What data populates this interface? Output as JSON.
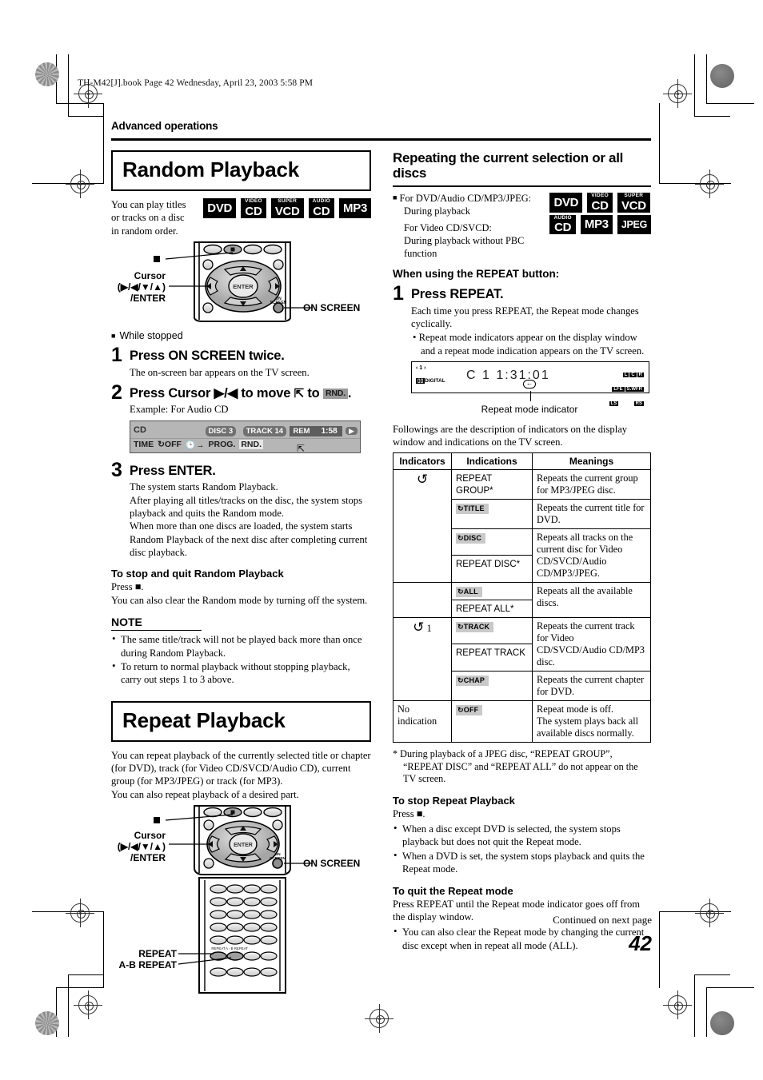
{
  "print_header": "TH-M42[J].book  Page 42  Wednesday, April 23, 2003  5:58 PM",
  "section_label": "Advanced operations",
  "page_number": "42",
  "continued": "Continued on next page",
  "random": {
    "title": "Random Playback",
    "intro": "You can play titles or tracks on a disc in random order.",
    "badges": [
      {
        "top": "",
        "main": "DVD"
      },
      {
        "top": "VIDEO",
        "main": "CD"
      },
      {
        "top": "SUPER",
        "main": "VCD"
      },
      {
        "top": "AUDIO",
        "main": "CD"
      },
      {
        "top": "",
        "main": "MP3"
      }
    ],
    "remote_callouts": {
      "stop": "■",
      "cursor_l1": "Cursor",
      "cursor_l2": "(▶/◀/▼/▲)",
      "cursor_l3": "/ENTER",
      "on_screen": "ON SCREEN",
      "enter": "ENTER"
    },
    "while_stopped": "While stopped",
    "steps": [
      {
        "num": "1",
        "title": "Press ON SCREEN twice.",
        "body": "The on-screen bar appears on the TV screen."
      },
      {
        "num": "2",
        "title_pre": "Press Cursor ▶/◀ to move",
        "title_mid": "to",
        "title_chip": "RND.",
        "title_end": ".",
        "body": "Example: For Audio CD"
      },
      {
        "num": "3",
        "title": "Press ENTER.",
        "body": "The system starts Random Playback.\nAfter playing all titles/tracks on the disc, the system stops playback and quits the Random mode.\nWhen more than one discs are loaded, the system starts Random Playback of the next disc after completing current disc playback."
      }
    ],
    "osd": {
      "disc_type": "CD",
      "disc": "DISC 3",
      "track": "TRACK 14",
      "rem_label": "REM",
      "rem_time": "1:58",
      "arrow": "▶",
      "items": [
        "TIME",
        "OFF",
        "PROG.",
        "RND."
      ],
      "repeat_item": "OFF",
      "clock_item": "→",
      "selected": "RND."
    },
    "stop_heading": "To stop and quit Random Playback",
    "stop_press": "Press ■.",
    "stop_note": "You can also clear the Random mode by turning off the system.",
    "note_heading": "NOTE",
    "notes": [
      "The same title/track will not be played back more than once during Random Playback.",
      "To return to normal playback without stopping playback, carry out steps 1 to 3 above."
    ]
  },
  "repeat": {
    "title": "Repeat Playback",
    "intro": "You can repeat playback of the currently selected title or chapter (for DVD), track (for Video CD/SVCD/Audio CD), current group (for MP3/JPEG) or track (for MP3).\nYou can also repeat playback of a desired part.",
    "callouts": {
      "stop": "■",
      "cursor_l1": "Cursor",
      "cursor_l2": "(▶/◀/▼/▲)",
      "cursor_l3": "/ENTER",
      "on_screen": "ON SCREEN",
      "repeat": "REPEAT",
      "ab_repeat": "A-B REPEAT",
      "key_repeat": "REPEAT",
      "key_ab": "A-B REPEAT"
    }
  },
  "repeating": {
    "title": "Repeating the current selection or all discs",
    "cond_line1": "For DVD/Audio CD/MP3/JPEG:",
    "cond_line2": "During playback",
    "cond_line3": "For Video CD/SVCD:",
    "cond_line4": "During playback without PBC function",
    "badges": [
      {
        "top": "",
        "main": "DVD"
      },
      {
        "top": "VIDEO",
        "main": "CD"
      },
      {
        "top": "SUPER",
        "main": "VCD"
      },
      {
        "top": "AUDIO",
        "main": "CD"
      },
      {
        "top": "",
        "main": "MP3"
      },
      {
        "top": "",
        "main": "JPEG"
      }
    ],
    "when_using": "When using the REPEAT button:",
    "step": {
      "num": "1",
      "title": "Press REPEAT.",
      "body": "Each time you press REPEAT, the Repeat mode changes cyclically.",
      "bullet": "Repeat mode indicators appear on the display window and a repeat mode indication appears on the TV screen."
    },
    "display": {
      "top_left": "‹ 1 ›",
      "bottom_left": "DIGITAL",
      "segments": "C 1      1:31:01",
      "right_indicators": [
        "L",
        "C",
        "R",
        "LFE",
        "S.WFR",
        "LS",
        "RS"
      ]
    },
    "caption": "Repeat mode indicator",
    "table_intro": "Followings are the description of indicators on the display window and indications on the TV screen.",
    "table": {
      "headers": [
        "Indicators",
        "Indications",
        "Meanings"
      ],
      "rows": [
        {
          "indicator": "↺",
          "indicator_style": "arrow",
          "indicator_suffix": "",
          "indications": [
            {
              "text": "REPEAT GROUP*",
              "style": "plain"
            }
          ],
          "meaning": "Repeats the current group for MP3/JPEG disc."
        },
        {
          "indications": [
            {
              "text": "TITLE",
              "style": "chip"
            }
          ],
          "meaning": "Repeats the current title for DVD."
        },
        {
          "indications": [
            {
              "text": "DISC",
              "style": "chip"
            },
            {
              "text": "REPEAT DISC*",
              "style": "plain"
            }
          ],
          "meaning": "Repeats all tracks on the current disc for Video CD/SVCD/Audio CD/MP3/JPEG."
        },
        {
          "indications": [
            {
              "text": "ALL",
              "style": "chip"
            },
            {
              "text": "REPEAT ALL*",
              "style": "plain"
            }
          ],
          "meaning": "Repeats all the available discs."
        },
        {
          "indicator": "↺",
          "indicator_style": "arrow",
          "indicator_suffix": "1",
          "indications": [
            {
              "text": "TRACK",
              "style": "chip"
            },
            {
              "text": "REPEAT TRACK",
              "style": "plain"
            }
          ],
          "meaning": "Repeats the current track for Video CD/SVCD/Audio CD/MP3 disc."
        },
        {
          "indications": [
            {
              "text": "CHAP",
              "style": "chip"
            }
          ],
          "meaning": "Repeats the current chapter for DVD."
        },
        {
          "indicator": "No indication",
          "indicator_style": "text",
          "indications": [
            {
              "text": "OFF",
              "style": "chip"
            }
          ],
          "meaning": "Repeat mode is off.\nThe system plays back all available discs normally."
        }
      ]
    },
    "footnote": "* During playback of a JPEG disc, “REPEAT GROUP”, “REPEAT DISC” and “REPEAT ALL” do not appear on the TV screen.",
    "stop_heading": "To stop Repeat Playback",
    "stop_press": "Press ■.",
    "stop_bullets": [
      "When a disc except DVD is selected, the system stops playback but does not quit the Repeat mode.",
      "When a DVD is set, the system stops playback and quits the Repeat mode."
    ],
    "quit_heading": "To quit the Repeat mode",
    "quit_body": "Press REPEAT until the Repeat mode indicator goes off from the display window.",
    "quit_bullets": [
      "You can also clear the Repeat mode by changing the current disc except when in repeat all mode (ALL)."
    ]
  }
}
